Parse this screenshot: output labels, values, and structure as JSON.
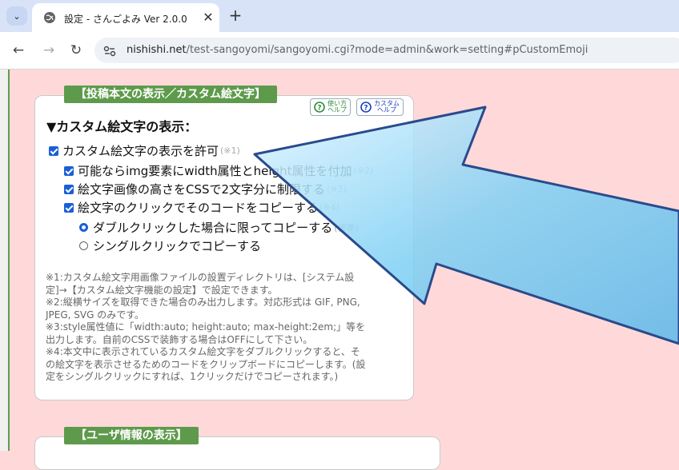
{
  "browser": {
    "tab_title": "設定 - さんごよみ Ver 2.0.0",
    "url_host": "nishishi.net",
    "url_path": "/test-sangoyomi/sangoyomi.cgi?mode=admin&work=setting#pCustomEmoji"
  },
  "section1": {
    "title": "【投稿本文の表示／カスタム絵文字】",
    "help1_line1": "使い方",
    "help1_line2": "ヘルプ",
    "help2_line1": "カスタム",
    "help2_line2": "ヘルプ",
    "heading": "▼カスタム絵文字の表示：",
    "opt_main": "カスタム絵文字の表示を許可",
    "opt_main_note": "(※1)",
    "opt_img": "可能ならimg要素にwidth属性とheight属性を付加",
    "opt_img_note": "(※2)",
    "opt_css": "絵文字画像の高さをCSSで2文字分に制限する",
    "opt_css_note": "(※3)",
    "opt_click": "絵文字のクリックでそのコードをコピーする",
    "opt_click_note": "(※4)",
    "radio_double": "ダブルクリックした場合に限ってコピーする",
    "radio_double_note": "(標準)",
    "radio_single": "シングルクリックでコピーする",
    "footnotes": [
      "※1:カスタム絵文字用画像ファイルの設置ディレクトリは、[システム設",
      "定]→【カスタム絵文字機能の設定】で設定できます。",
      "※2:縦横サイズを取得できた場合のみ出力します。対応形式は GIF, PNG,",
      "JPEG, SVG のみです。",
      "※3:style属性値に「width:auto; height:auto; max-height:2em;」等を",
      "出力します。自前のCSSで装飾する場合はOFFにして下さい。",
      "※4:本文中に表示されているカスタム絵文字をダブルクリックすると、そ",
      "の絵文字を表示させるためのコードをクリップボードにコピーします。(設",
      "定をシングルクリックにすれば、1クリックだけでコピーされます。)"
    ]
  },
  "section2": {
    "title": "【ユーザ情報の表示】"
  },
  "colors": {
    "page_bg": "#ffd9d9",
    "section_title_bg": "#5e9a4c",
    "checkbox": "#1a5fd6",
    "arrow": "#8fd3f5"
  }
}
